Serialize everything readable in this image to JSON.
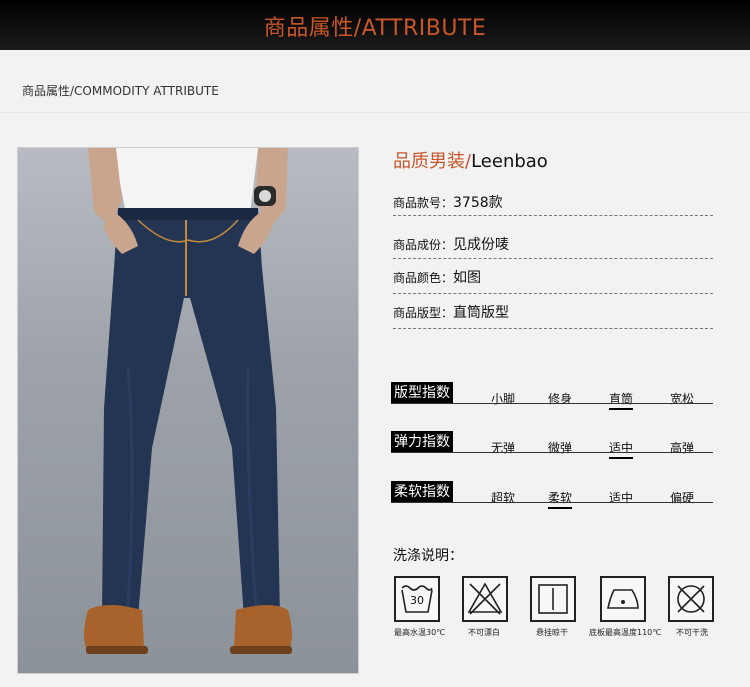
{
  "header": {
    "title": "商品属性/ATTRIBUTE"
  },
  "section": {
    "label": "商品属性/COMMODITY ATTRIBUTE"
  },
  "brand": {
    "cn": "品质男装/",
    "en": "Leenbao"
  },
  "attributes": [
    {
      "label": "商品款号：",
      "value": "3758款"
    },
    {
      "label": "商品成份：",
      "value": "见成份唛"
    },
    {
      "label": "商品颜色：",
      "value": "如图"
    },
    {
      "label": "商品版型：",
      "value": "直筒版型"
    }
  ],
  "indices": [
    {
      "title": "版型指数",
      "options": [
        "小脚",
        "修身",
        "直筒",
        "宽松"
      ],
      "selected": 2
    },
    {
      "title": "弹力指数",
      "options": [
        "无弹",
        "微弹",
        "适中",
        "高弹"
      ],
      "selected": 2
    },
    {
      "title": "柔软指数",
      "options": [
        "超软",
        "柔软",
        "适中",
        "偏硬"
      ],
      "selected": 1
    }
  ],
  "wash": {
    "title": "洗涤说明：",
    "items": [
      {
        "icon": "wash-30-icon",
        "number": "30",
        "caption": "最高水温30℃"
      },
      {
        "icon": "no-bleach-icon",
        "caption": "不可漂白"
      },
      {
        "icon": "hang-dry-icon",
        "caption": "悬挂晾干"
      },
      {
        "icon": "iron-110-icon",
        "caption": "底板最高温度110℃"
      },
      {
        "icon": "no-dry-clean-icon",
        "caption": "不可干洗"
      }
    ]
  },
  "colors": {
    "accent": "#c8562a",
    "banner": "#000000",
    "denim": "#23324a",
    "shoe": "#a8622b"
  }
}
